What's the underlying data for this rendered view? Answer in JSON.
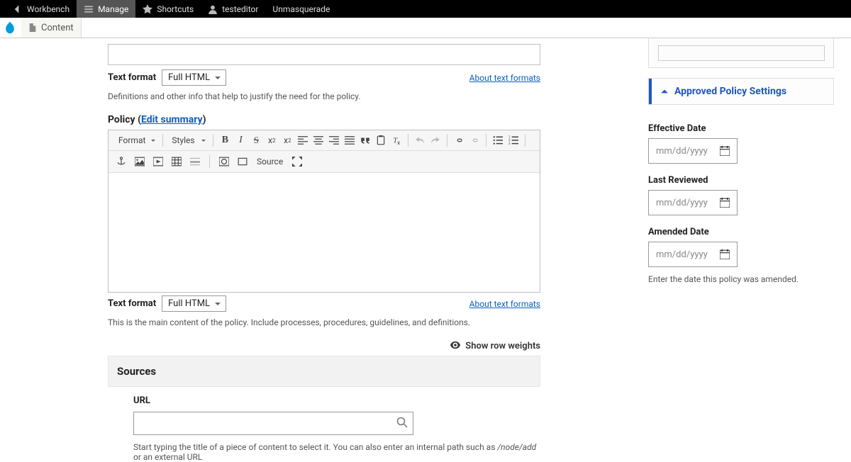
{
  "topbar": {
    "workbench": "Workbench",
    "manage": "Manage",
    "shortcuts": "Shortcuts",
    "user": "testeditor",
    "unmasq": "Unmasquerade"
  },
  "secondbar": {
    "content": "Content"
  },
  "tf": {
    "label": "Text format",
    "value": "Full HTML",
    "link": "About text formats"
  },
  "help1": "Definitions and other info that help to justify the need for the policy.",
  "policy": {
    "label": "Policy (",
    "link": "Edit summary",
    "close": ")"
  },
  "cke": {
    "format": "Format",
    "styles": "Styles",
    "source": "Source"
  },
  "help2": "This is the main content of the policy. Include processes, procedures, guidelines, and definitions.",
  "weights": "Show row weights",
  "sources": {
    "title": "Sources",
    "url_label": "URL",
    "help_pre": "Start typing the title of a piece of content to select it. You can also enter an internal path such as ",
    "help_em": "/node/add",
    "help_post": " or an external URL"
  },
  "sidebar": {
    "title": "Approved Policy Settings",
    "effective": "Effective Date",
    "reviewed": "Last Reviewed",
    "amended": "Amended Date",
    "date_ph": "mm/dd/yyyy",
    "amended_help": "Enter the date this policy was amended."
  }
}
